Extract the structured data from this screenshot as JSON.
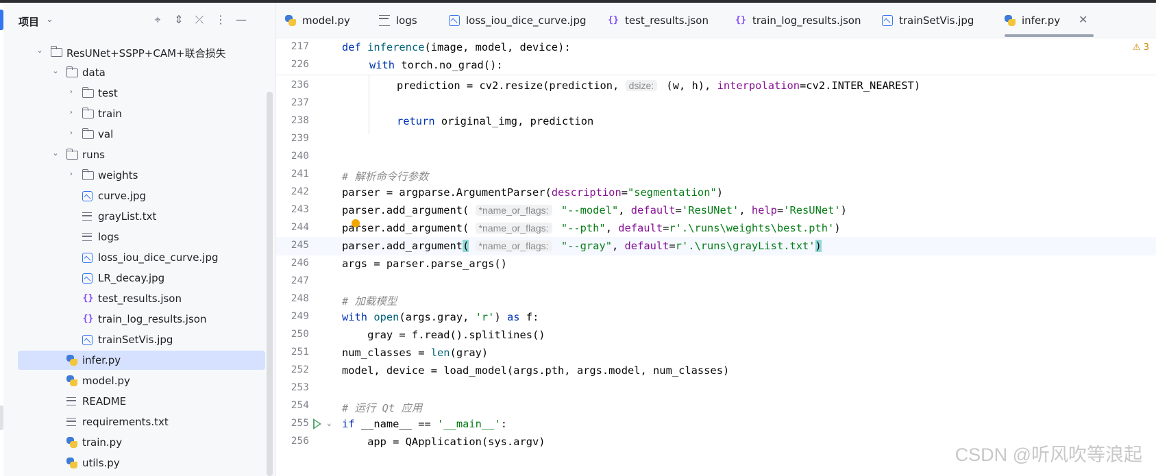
{
  "sidebar": {
    "title": "项目",
    "tree": [
      {
        "label": "ResUNet+SSPP+CAM+联合损失",
        "type": "folder",
        "depth": 1,
        "expanded": true
      },
      {
        "label": "data",
        "type": "folder",
        "depth": 2,
        "expanded": true
      },
      {
        "label": "test",
        "type": "folder",
        "depth": 3,
        "expanded": false
      },
      {
        "label": "train",
        "type": "folder",
        "depth": 3,
        "expanded": false
      },
      {
        "label": "val",
        "type": "folder",
        "depth": 3,
        "expanded": false
      },
      {
        "label": "runs",
        "type": "folder",
        "depth": 2,
        "expanded": true
      },
      {
        "label": "weights",
        "type": "folder",
        "depth": 3,
        "expanded": false
      },
      {
        "label": "curve.jpg",
        "type": "image",
        "depth": 3
      },
      {
        "label": "grayList.txt",
        "type": "text",
        "depth": 3
      },
      {
        "label": "logs",
        "type": "text",
        "depth": 3
      },
      {
        "label": "loss_iou_dice_curve.jpg",
        "type": "image",
        "depth": 3
      },
      {
        "label": "LR_decay.jpg",
        "type": "image",
        "depth": 3
      },
      {
        "label": "test_results.json",
        "type": "json",
        "depth": 3
      },
      {
        "label": "train_log_results.json",
        "type": "json",
        "depth": 3
      },
      {
        "label": "trainSetVis.jpg",
        "type": "image",
        "depth": 3
      },
      {
        "label": "infer.py",
        "type": "python",
        "depth": 2,
        "selected": true
      },
      {
        "label": "model.py",
        "type": "python",
        "depth": 2
      },
      {
        "label": "README",
        "type": "text",
        "depth": 2
      },
      {
        "label": "requirements.txt",
        "type": "text",
        "depth": 2
      },
      {
        "label": "train.py",
        "type": "python",
        "depth": 2
      },
      {
        "label": "utils.py",
        "type": "python",
        "depth": 2
      }
    ]
  },
  "tabs": [
    {
      "label": "model.py",
      "type": "python"
    },
    {
      "label": "logs",
      "type": "text"
    },
    {
      "label": "loss_iou_dice_curve.jpg",
      "type": "image"
    },
    {
      "label": "test_results.json",
      "type": "json"
    },
    {
      "label": "train_log_results.json",
      "type": "json"
    },
    {
      "label": "trainSetVis.jpg",
      "type": "image"
    },
    {
      "label": "infer.py",
      "type": "python",
      "active": true
    }
  ],
  "editor": {
    "warning_count": "3",
    "sticky_lines": [
      {
        "num": "217"
      },
      {
        "num": "226"
      }
    ],
    "lines": [
      {
        "num": "236"
      },
      {
        "num": "237"
      },
      {
        "num": "238"
      },
      {
        "num": "239"
      },
      {
        "num": "240"
      },
      {
        "num": "241"
      },
      {
        "num": "242"
      },
      {
        "num": "243"
      },
      {
        "num": "244"
      },
      {
        "num": "245"
      },
      {
        "num": "246"
      },
      {
        "num": "247"
      },
      {
        "num": "248"
      },
      {
        "num": "249"
      },
      {
        "num": "250"
      },
      {
        "num": "251"
      },
      {
        "num": "252"
      },
      {
        "num": "253"
      },
      {
        "num": "254"
      },
      {
        "num": "255"
      },
      {
        "num": "256"
      }
    ],
    "code": {
      "l217_def": "def ",
      "l217_fn": "inference",
      "l217_rest": "(image, model, device):",
      "l226_with": "with ",
      "l226_rest": "torch.no_grad():",
      "l236_a": "prediction = cv2.resize(prediction, ",
      "l236_hint": "dsize:",
      "l236_b": " (w, h), ",
      "l236_param": "interpolation",
      "l236_c": "=cv2.INTER_NEAREST)",
      "l238_kw": "return ",
      "l238_rest": "original_img, prediction",
      "l241": "# 解析命令行参数",
      "l242_a": "parser = argparse.ArgumentParser(",
      "l242_param": "description",
      "l242_b": "=",
      "l242_str": "\"segmentation\"",
      "l242_c": ")",
      "l243_a": "parser.add_argument( ",
      "l243_hint": "*name_or_flags:",
      "l243_s1": " \"--model\"",
      "l243_b": ", ",
      "l243_p1": "default",
      "l243_eq1": "=",
      "l243_s2": "'ResUNet'",
      "l243_c": ", ",
      "l243_p2": "help",
      "l243_eq2": "=",
      "l243_s3": "'ResUNet'",
      "l243_d": ")",
      "l244_a": "parser.add_argument( ",
      "l244_hint": "*name_or_flags:",
      "l244_s1": " \"--pth\"",
      "l244_b": ", ",
      "l244_p1": "default",
      "l244_eq": "=",
      "l244_s2": "r'.\\runs\\weights\\best.pth'",
      "l244_c": ")",
      "l245_a": "parser.add_argument",
      "l245_open": "(",
      "l245_sp": " ",
      "l245_hint": "*name_or_flags:",
      "l245_s1": " \"--gray\"",
      "l245_b": ", ",
      "l245_p1": "default",
      "l245_eq": "=",
      "l245_s2": "r'.\\runs\\grayList.txt'",
      "l245_close": ")",
      "l246": "args = parser.parse_args()",
      "l248": "# 加载模型",
      "l249_kw": "with ",
      "l249_fn": "open",
      "l249_a": "(args.gray, ",
      "l249_str": "'r'",
      "l249_b": ") ",
      "l249_as": "as",
      "l249_c": " f:",
      "l250": "    gray = f.read().splitlines()",
      "l251_a": "num_classes = ",
      "l251_fn": "len",
      "l251_b": "(gray)",
      "l252": "model, device = load_model(args.pth, args.model, num_classes)",
      "l254": "# 运行 Qt 应用",
      "l255_kw": "if ",
      "l255_a": "__name__ == ",
      "l255_str": "'__main__'",
      "l255_b": ":",
      "l256": "    app = QApplication(sys.argv)"
    }
  },
  "watermark": "CSDN @听风吹等浪起",
  "colors": {
    "accent": "#3574f0",
    "selection": "#d5e1ff",
    "keyword": "#0033b3",
    "string": "#067d17",
    "parameter": "#871094",
    "comment": "#8c8c8c",
    "brace_match": "#93d9d9"
  }
}
